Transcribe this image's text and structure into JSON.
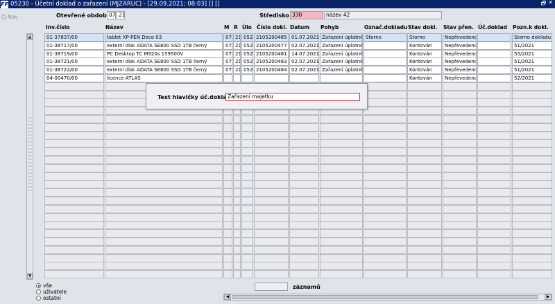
{
  "window": {
    "title": "05230 - Účetní doklad o zařazení (MJZARUC) - [29.09.2021; 08:03] [] []",
    "app_icon": "FF",
    "restore_glyph": "🗗",
    "close_glyph": "✕"
  },
  "nav": {
    "label": "Nav"
  },
  "header": {
    "period_label": "Otevřené období",
    "period_month": "07",
    "period_year": "21",
    "center_label": "Středisko",
    "center_code": "330",
    "center_name": "název 42"
  },
  "columns": [
    "Inv.číslo",
    "Název",
    "M",
    "R",
    "Úlo",
    "Číslo dokl.",
    "Datum",
    "Pohyb",
    "Označ.dokladu",
    "Stav dokl.",
    "Stav přen.",
    "Úč.doklad",
    "Pozn.k dokl."
  ],
  "rows": [
    [
      "01-37837/00",
      "tablet XP-PEN Deco 03",
      "07",
      "21",
      "052",
      "2105200485",
      "01.07.2021",
      "Zařazení úplatně",
      "Storno",
      "Storno",
      "Nepřevedeno",
      "",
      "Storno dokladu"
    ],
    [
      "01-38717/00",
      "externí disk ADATA SE800 SSD 1TB černý",
      "07",
      "21",
      "052",
      "2105200477",
      "02.07.2021",
      "Zařazení úplatně",
      "",
      "Kontován",
      "Nepřevedeno",
      "",
      "51/2021"
    ],
    [
      "01-38719/00",
      "PC Desktop TC M920s 159500V",
      "07",
      "21",
      "052",
      "2105200481",
      "14.07.2021",
      "Zařazení úplatně",
      "",
      "Kontován",
      "Nepřevedeno",
      "",
      "55/2021"
    ],
    [
      "01-38721/00",
      "externí disk ADATA SE800 SSD 1TB černý",
      "07",
      "21",
      "052",
      "2105200483",
      "02.07.2021",
      "Zařazení úplatně",
      "",
      "Kontován",
      "Nepřevedeno",
      "",
      "51/2021"
    ],
    [
      "01-38722/00",
      "externí disk ADATA SE800 SSD 1TB černý",
      "07",
      "21",
      "052",
      "2105200484",
      "02.07.2021",
      "Zařazení úplatně",
      "",
      "Kontován",
      "Nepřevedeno",
      "",
      "51/2021"
    ],
    [
      "04-00470/00",
      "licence ATLAS",
      "",
      "",
      "",
      "",
      "",
      "",
      "",
      "Kontován",
      "Nepřevedeno",
      "",
      "52/2021"
    ]
  ],
  "filter": {
    "options": [
      "vše",
      "uživatele",
      "ostatní"
    ],
    "selected": "vše"
  },
  "footer": {
    "count_label": "záznamů"
  },
  "popup": {
    "label": "Text hlavičky úč.dokladu",
    "value": "Zařazení majetku"
  },
  "colors": {
    "title_bar": "#0a246a",
    "center_code_bg": "#f5b7c0",
    "selected_row": "#d4e4f7",
    "popup_border": "#c9343b"
  }
}
